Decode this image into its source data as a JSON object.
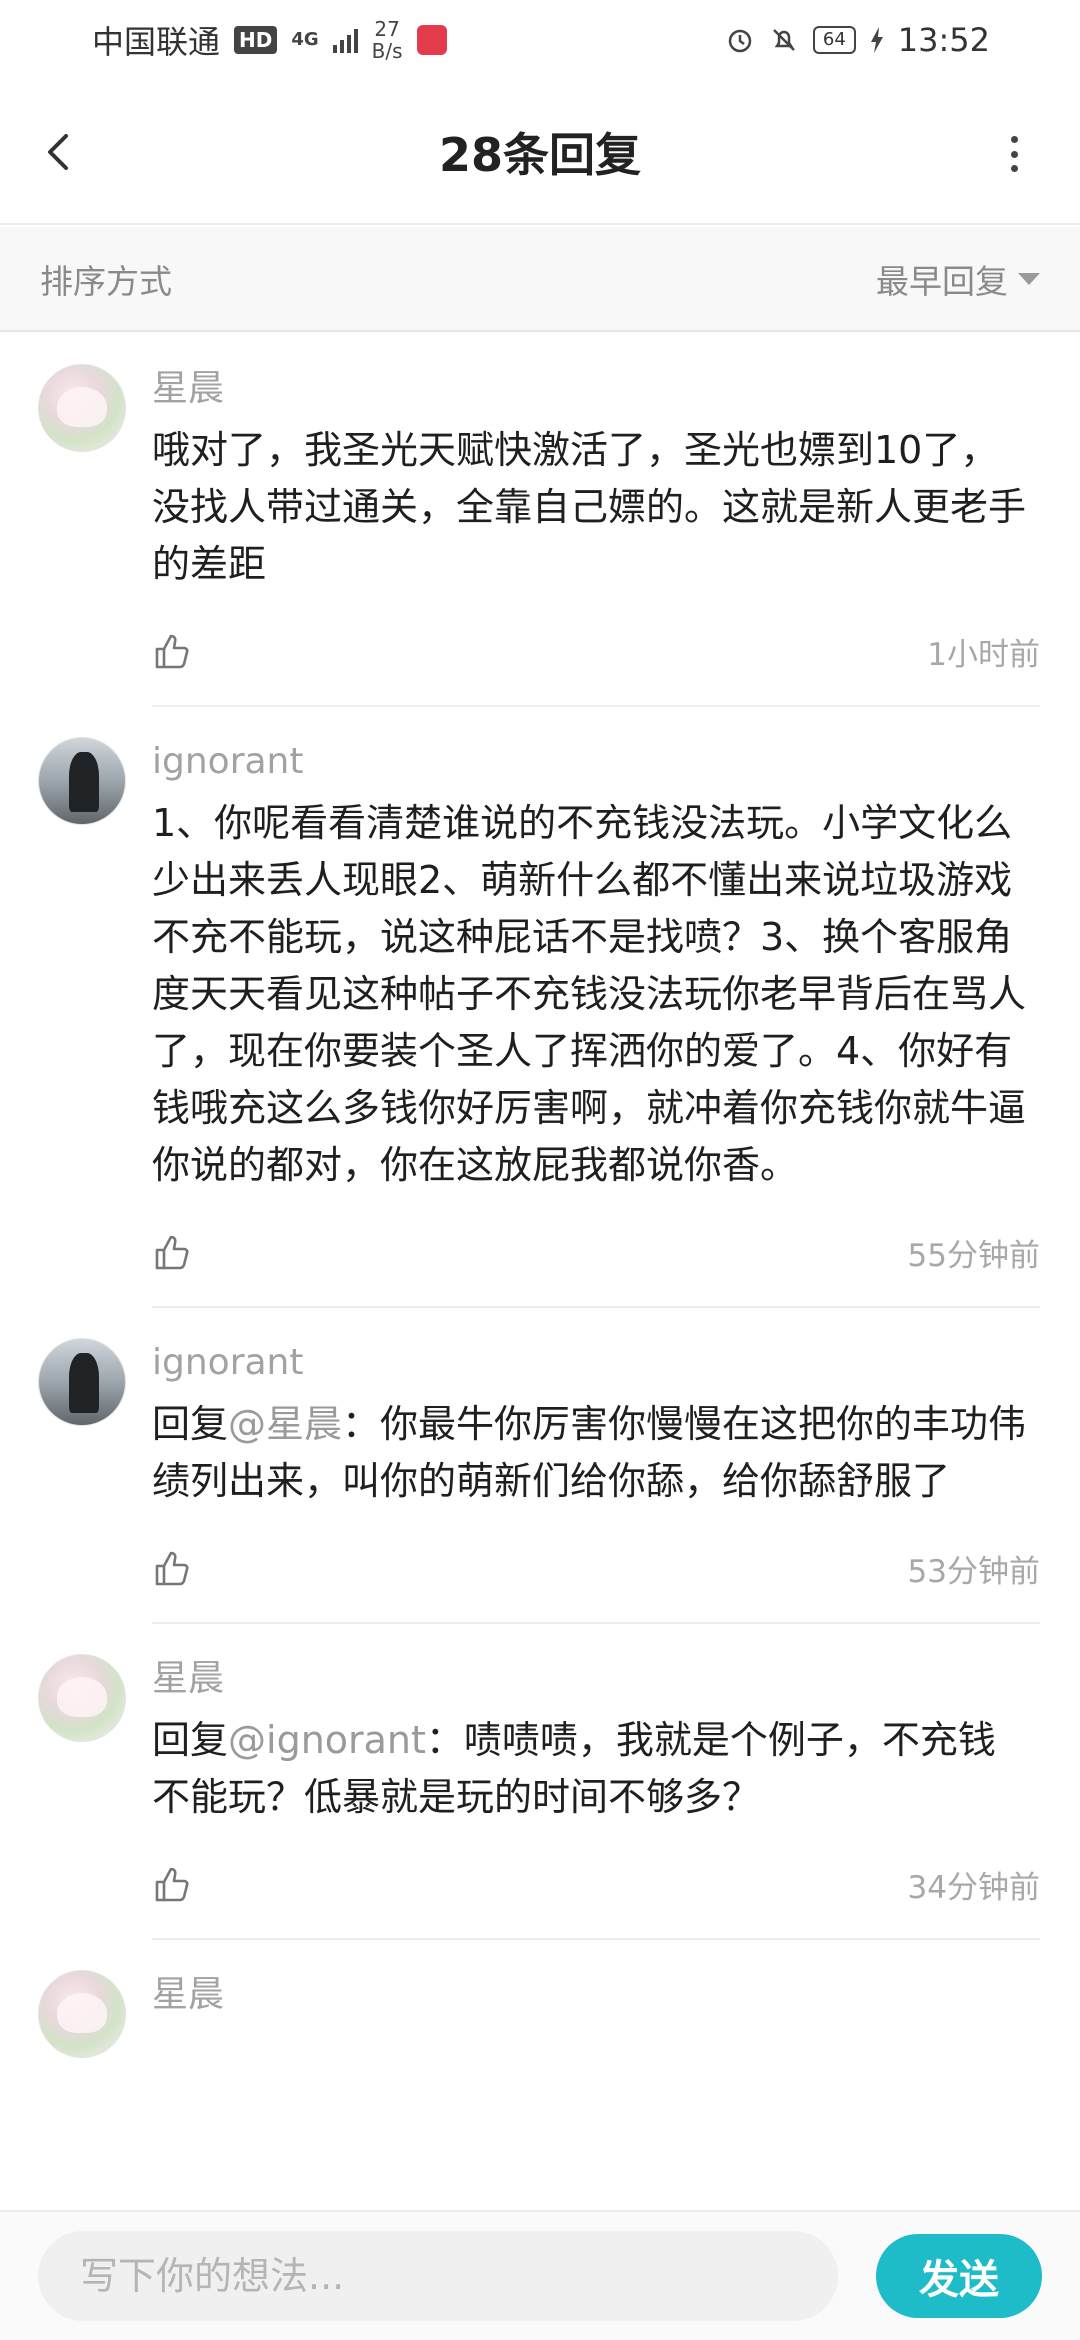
{
  "status_bar": {
    "carrier": "中国联通",
    "hd": "HD",
    "net": "4G",
    "speed_value": "27",
    "speed_unit": "B/s",
    "battery": "64",
    "time": "13:52"
  },
  "header": {
    "title": "28条回复"
  },
  "sort": {
    "label": "排序方式",
    "selected": "最早回复"
  },
  "comments": [
    {
      "user": "星晨",
      "avatar": "anime-avatar",
      "content": "哦对了，我圣光天赋快激活了，圣光也嫖到10了，没找人带过通关，全靠自己嫖的。这就是新人更老手的差距",
      "time": "1小时前"
    },
    {
      "user": "ignorant",
      "avatar": "photo-avatar",
      "content": "1、你呢看看清楚谁说的不充钱没法玩。小学文化么少出来丢人现眼2、萌新什么都不懂出来说垃圾游戏不充不能玩，说这种屁话不是找喷？3、换个客服角度天天看见这种帖子不充钱没法玩你老早背后在骂人了，现在你要装个圣人了挥洒你的爱了。4、你好有钱哦充这么多钱你好厉害啊，就冲着你充钱你就牛逼你说的都对，你在这放屁我都说你香。",
      "time": "55分钟前"
    },
    {
      "user": "ignorant",
      "avatar": "photo-avatar",
      "reply_prefix": "回复",
      "reply_to": "@星晨",
      "content": "：你最牛你厉害你慢慢在这把你的丰功伟绩列出来，叫你的萌新们给你舔，给你舔舒服了",
      "time": "53分钟前"
    },
    {
      "user": "星晨",
      "avatar": "anime-avatar",
      "reply_prefix": "回复",
      "reply_to": "@ignorant",
      "content": "：啧啧啧，我就是个例子，不充钱不能玩？低暴就是玩的时间不够多？",
      "time": "34分钟前"
    },
    {
      "user": "星晨",
      "avatar": "anime-avatar",
      "content": "",
      "time": ""
    }
  ],
  "composer": {
    "placeholder": "写下你的想法...",
    "send_label": "发送"
  },
  "colors": {
    "accent": "#1ebcc8",
    "muted_text": "#a2a2a2"
  }
}
